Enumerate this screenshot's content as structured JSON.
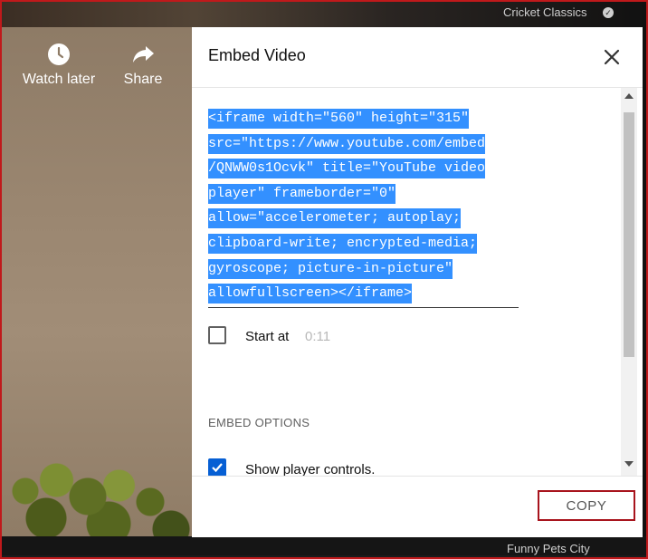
{
  "player": {
    "watch_later_label": "Watch later",
    "share_label": "Share",
    "top_channel": "Cricket Classics",
    "bottom_channel": "Funny Pets City"
  },
  "dialog": {
    "title": "Embed Video",
    "code_lines": [
      "<iframe width=\"560\" height=\"315\"",
      "src=\"https://www.youtube.com/embed",
      "/QNWW0s1Ocvk\" title=\"YouTube video",
      "player\" frameborder=\"0\"",
      "allow=\"accelerometer; autoplay;",
      "clipboard-write; encrypted-media;",
      "gyroscope; picture-in-picture\"",
      "allowfullscreen></iframe>"
    ],
    "start_at_label": "Start at",
    "start_at_time": "0:11",
    "start_at_checked": false,
    "embed_options_title": "EMBED OPTIONS",
    "options": [
      {
        "label": "Show player controls.",
        "checked": true
      }
    ],
    "copy_label": "COPY"
  },
  "colors": {
    "selection": "#3390ff",
    "checkbox_checked": "#065fd4",
    "copy_border": "#a8141d",
    "frame_border": "#c0191b"
  },
  "icons": {
    "watch_later": "clock-icon",
    "share": "share-arrow-icon",
    "close": "close-icon",
    "check": "check-icon"
  }
}
